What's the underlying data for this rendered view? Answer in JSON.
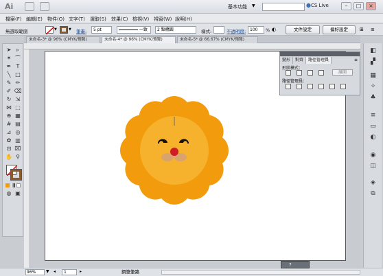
{
  "app": {
    "logo_text": "Ai"
  },
  "titlebar": {
    "workspace": "基本功能",
    "cs_live": "CS Live",
    "window_buttons": [
      "–",
      "□",
      "×"
    ]
  },
  "menu": [
    "檔案(F)",
    "編輯(E)",
    "物件(O)",
    "文字(T)",
    "選取(S)",
    "效果(C)",
    "檢視(V)",
    "視窗(W)",
    "說明(H)"
  ],
  "controlbar": {
    "selection_label": "無選取範圍",
    "stroke_label": "筆畫:",
    "stroke_value": "5 pt",
    "profile_value": "一致",
    "brush_value": "2 點橢圓",
    "style_label": "樣式:",
    "opacity_label": "不透明度:",
    "opacity_value": "100",
    "percent": "%",
    "doc_setup": "文件設定",
    "preferences": "偏好設定"
  },
  "tabs": [
    {
      "label": "未命名-3* @ 96% (CMYK/預覽)",
      "active": false
    },
    {
      "label": "未命名-4* @ 96% (CMYK/預覽)",
      "active": true
    },
    {
      "label": "未命名-5* @ 66.67% (CMYK/預覽)",
      "active": false
    }
  ],
  "panel": {
    "tabs": [
      "變形",
      "對齊",
      "路徑管理員"
    ],
    "active_tab": 2,
    "shape_modes_label": "形狀模式：",
    "pathfinders_label": "路徑管理員：",
    "expand_label": "展開"
  },
  "statusbar": {
    "zoom": "96%",
    "page": "1",
    "status": "鋼筆筆路"
  },
  "colors": {
    "mane": "#f29b0d",
    "face": "#f7b22d",
    "nose": "#d01c26",
    "muzzle": "#d9a36d",
    "eye": "#111111",
    "mane_line": "#b58b4a"
  }
}
